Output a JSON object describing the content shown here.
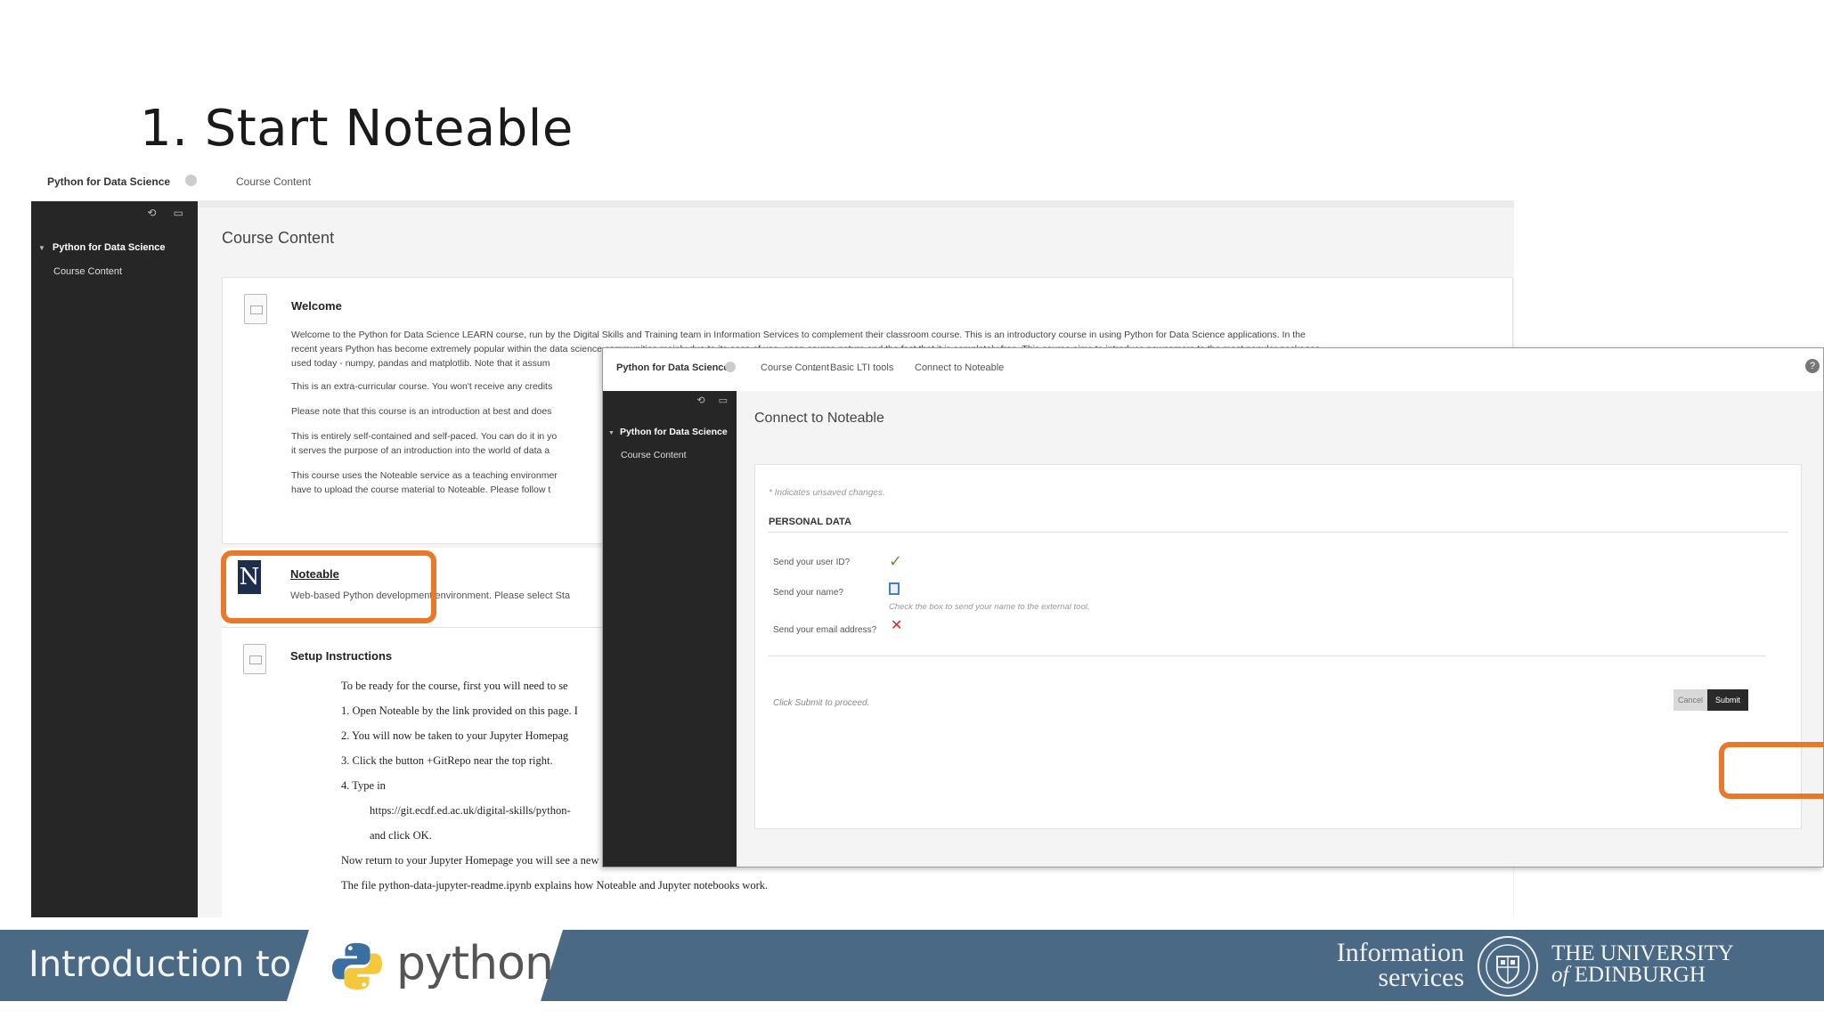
{
  "slide": {
    "title": "1. Start Noteable"
  },
  "background_screen": {
    "breadcrumb": {
      "course": "Python for Data Science",
      "page": "Course Content"
    },
    "sidebar": {
      "course": "Python for Data Science",
      "item": "Course Content"
    },
    "page_heading": "Course Content",
    "welcome": {
      "title": "Welcome",
      "paragraphs": [
        "Welcome to the Python for Data Science LEARN course, run by the Digital Skills and Training team in Information Services to complement their classroom course. This is an introductory course in using Python for Data Science applications. In the",
        "recent years Python has become extremely popular within the data science communities mainly due to its ease of use, open-source nature and the fact that it is completely free. This course aims to introduce newcomers to the most popular packages",
        "used today - numpy, pandas and matplotlib. Note that it assum",
        "This is an extra-curricular course. You won't receive any credits",
        "Please note that this course is an introduction at best and does",
        "This is entirely self-contained and self-paced. You can do it in yo",
        "it serves the purpose of an introduction into the world of data a",
        "This course uses the Noteable service as a teaching environmer",
        "have to upload the course material to Noteable. Please follow t"
      ]
    },
    "noteable": {
      "title": "Noteable",
      "description": "Web-based Python development environment. Please select Sta"
    },
    "setup": {
      "title": "Setup Instructions",
      "lines": [
        "To be ready for the course, first you will need to se",
        "1. Open Noteable by the link provided on this page. I",
        "2. You will now be taken to your Jupyter Homepag",
        "3. Click the button +GitRepo near the top right.",
        "4. Type in",
        "https://git.ecdf.ed.ac.uk/digital-skills/python-",
        "and click OK.",
        "Now return to your Jupyter Homepage you will see a new folder has appeared called python-data-science, inside are all files needed for the course!",
        "The file python-data-jupyter-readme.ipynb explains how Noteable and Jupyter notebooks work."
      ]
    }
  },
  "foreground_screen": {
    "breadcrumb": {
      "course": "Python for Data Science",
      "c1": "Course Content",
      "sep": "...",
      "c2": "Basic LTI tools",
      "c3": "Connect to Noteable"
    },
    "sidebar": {
      "course": "Python for Data Science",
      "item": "Course Content"
    },
    "page_heading": "Connect to Noteable",
    "form": {
      "note": "* Indicates unsaved changes.",
      "section": "PERSONAL DATA",
      "fields": {
        "user_id": "Send your user ID?",
        "name": "Send your name?",
        "name_hint": "Check the box to send your name to the external tool.",
        "email": "Send your email address?"
      },
      "proceed_text": "Click Submit to proceed.",
      "cancel": "Cancel",
      "submit": "Submit"
    }
  },
  "footer": {
    "intro": "Introduction to",
    "python_word": "python",
    "info_line1": "Information",
    "info_line2": "services",
    "uni_line1": "THE UNIVERSITY",
    "uni_of": "of",
    "uni_line2": " EDINBURGH"
  },
  "colors": {
    "highlight": "#e8782a",
    "banner": "#4a6985",
    "sidebar": "#262626",
    "python_blue": "#3a6fa0",
    "python_yellow": "#f5c73b"
  }
}
